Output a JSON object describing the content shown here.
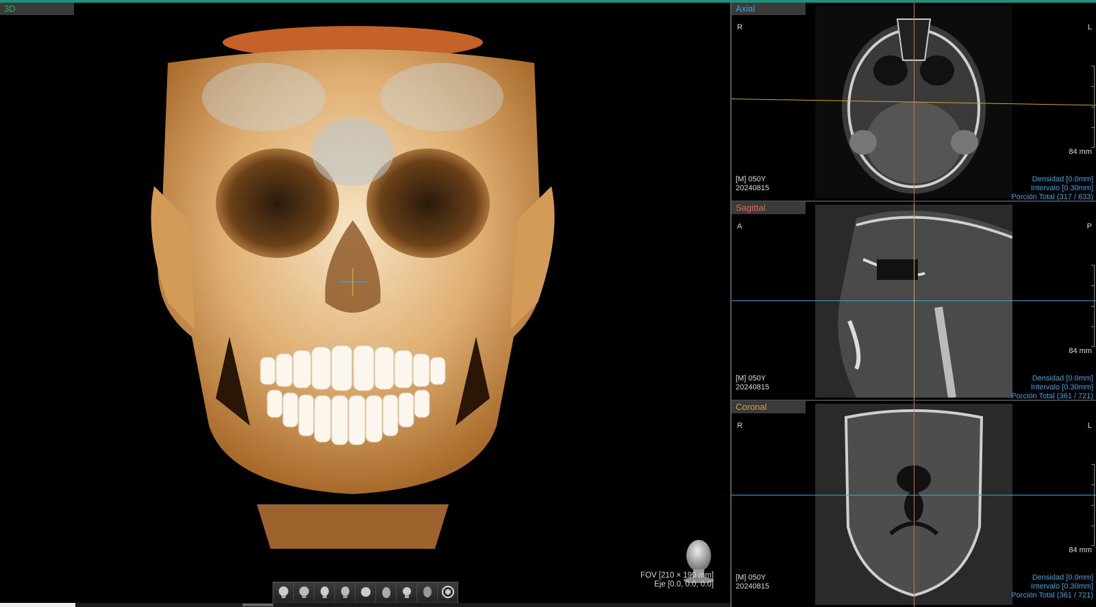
{
  "view3d": {
    "tab_label": "3D",
    "fov": "FOV [210 × 190 mm]",
    "axis": "Eje [0.0, 0.0, 0.0]",
    "toolbar_icons": [
      "view-front-icon",
      "view-back-icon",
      "view-right-icon",
      "view-left-icon",
      "view-top-icon",
      "view-bottom-icon",
      "view-oblique-icon",
      "view-reset-icon",
      "rotate-icon"
    ],
    "progress_fraction": 0.103
  },
  "slices": [
    {
      "id": "axial",
      "tab_label": "Axial",
      "orient_left": "R",
      "orient_right": "L",
      "scale": "84 mm",
      "patient_line1": "[M] 050Y",
      "patient_line2": "20240815",
      "density": "Densidad [0.0mm]",
      "interval": "Intervalo [0.30mm]",
      "portion": "Porción Total (317 / 633)"
    },
    {
      "id": "sagittal",
      "tab_label": "Sagittal",
      "orient_left": "A",
      "orient_right": "P",
      "scale": "84 mm",
      "patient_line1": "[M] 050Y",
      "patient_line2": "20240815",
      "density": "Densidad [0.0mm]",
      "interval": "Intervalo [0.30mm]",
      "portion": "Porción Total (361 / 721)"
    },
    {
      "id": "coronal",
      "tab_label": "Coronal",
      "orient_left": "R",
      "orient_right": "L",
      "scale": "84 mm",
      "patient_line1": "[M] 050Y",
      "patient_line2": "20240815",
      "density": "Densidad [0.0mm]",
      "interval": "Intervalo [0.30mm]",
      "portion": "Porción Total (361 / 721)"
    }
  ],
  "colors": {
    "accent_bar": "#1e8f7a",
    "axial": "#3aa0e0",
    "sagittal": "#e06a55",
    "coronal": "#d4a72c",
    "info_text": "#3aa3e6"
  }
}
